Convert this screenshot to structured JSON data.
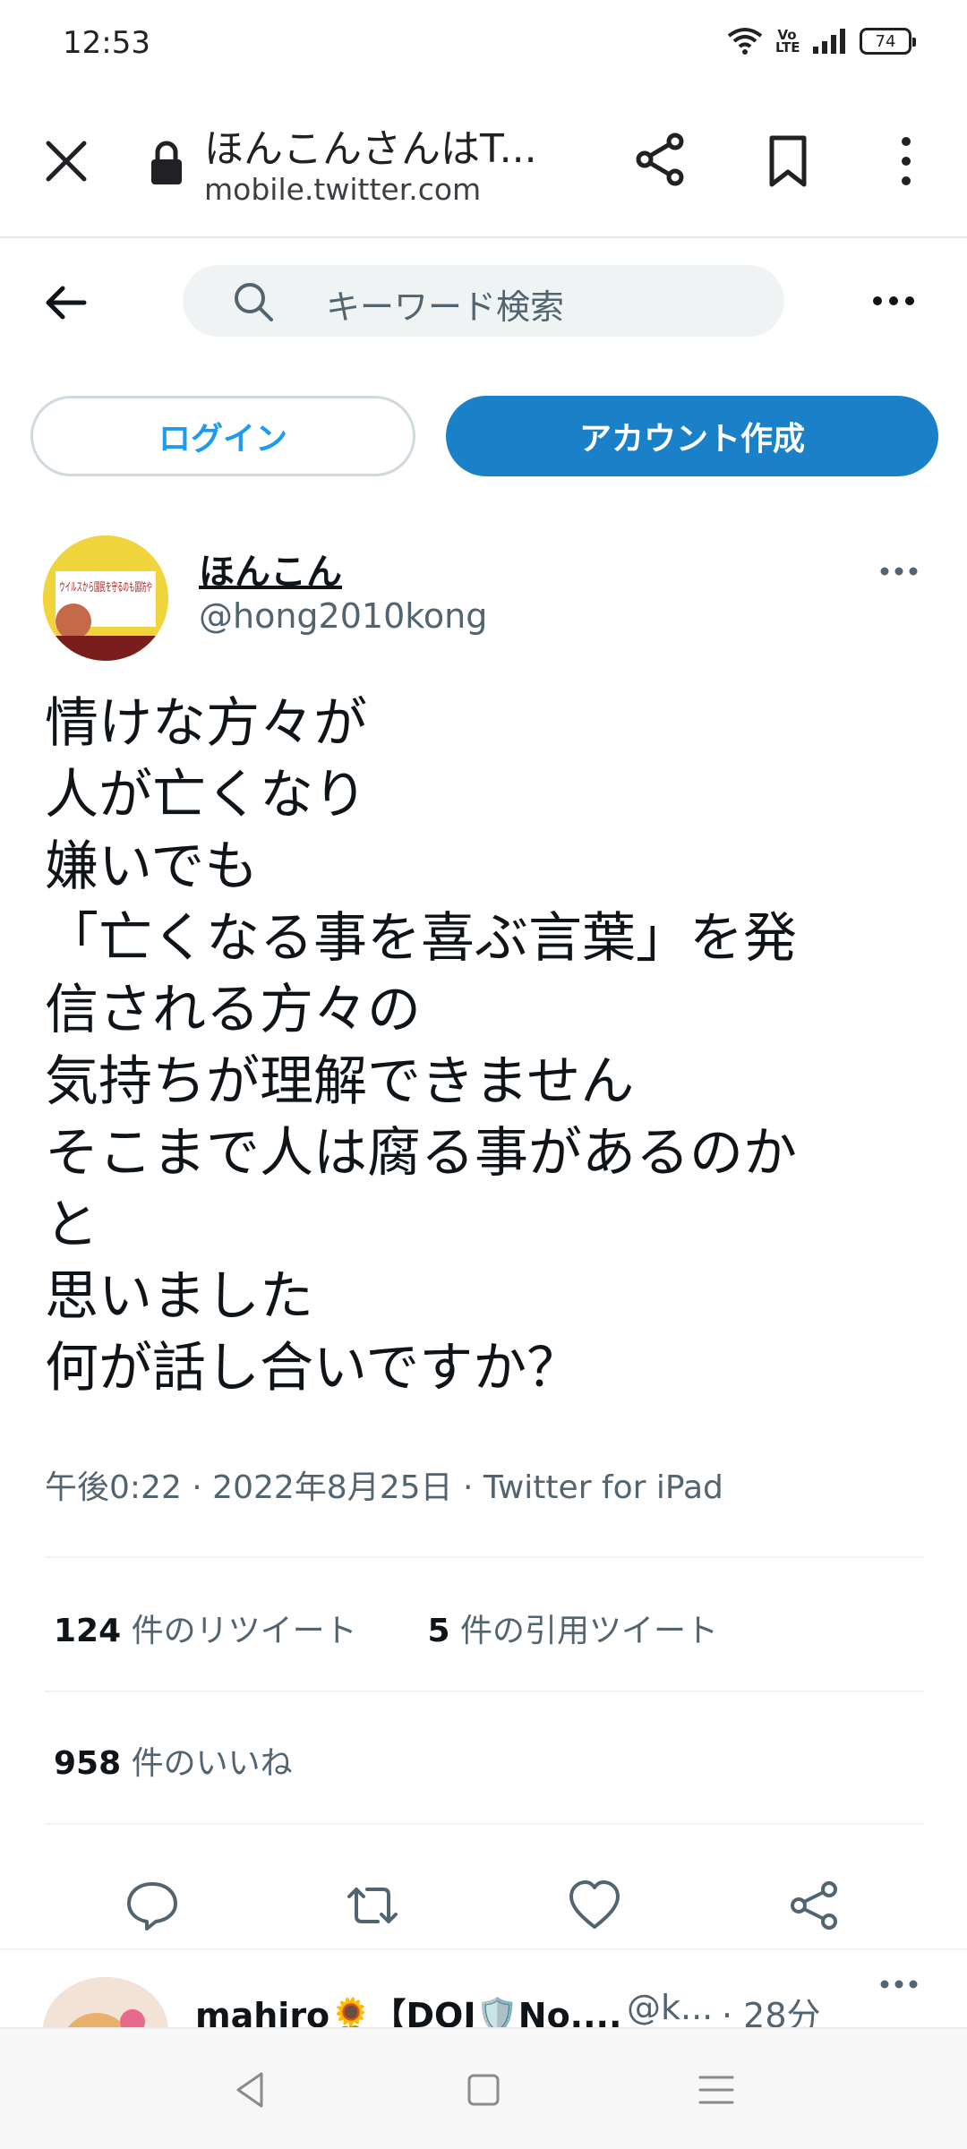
{
  "status_bar": {
    "time": "12:53",
    "volte": "Vo LTE",
    "battery": "74"
  },
  "browser": {
    "page_title": "ほんこんさんはT...",
    "url_host": "mobile.twitter.com"
  },
  "header": {
    "search_placeholder": "キーワード検索"
  },
  "auth": {
    "login_label": "ログイン",
    "signup_label": "アカウント作成"
  },
  "tweet": {
    "display_name": "ほんこん",
    "handle": "@hong2010kong",
    "avatar_text": "ウイルスから国民を守るのも国防や",
    "lines": [
      "情けな方々が",
      "人が亡くなり",
      "嫌いでも",
      "「亡くなる事を喜ぶ言葉」を発",
      "信される方々の",
      "気持ちが理解できません",
      "そこまで人は腐る事があるのか",
      "と",
      "思いました",
      "何が話し合いですか？"
    ],
    "meta": "午後0:22 · 2022年8月25日 · Twitter for iPad",
    "retweets_count": "124",
    "retweets_label": " 件のリツイート",
    "quotes_count": "5",
    "quotes_label": " 件の引用ツイート",
    "likes_count": "958",
    "likes_label": " 件のいいね"
  },
  "reply": {
    "name": "mahiro🌻【DOJ🛡️No....",
    "handle": "@k...",
    "time": "· 28分"
  },
  "colors": {
    "accent": "#1d9bf0",
    "signup_bg": "#1a80c8",
    "muted_text": "#536471"
  }
}
